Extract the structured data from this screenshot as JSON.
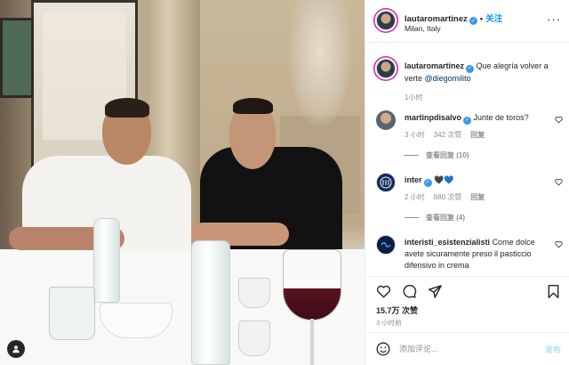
{
  "post": {
    "author": "lautaromartinez",
    "follow_label": "关注",
    "location": "Milan, Italy",
    "more_label": "···"
  },
  "comments": [
    {
      "user": "lautaromartinez",
      "verified": true,
      "text": "Que alegría volver a verte ",
      "mention": "@diegomilito",
      "time": "1小时"
    },
    {
      "user": "martinpdisalvo",
      "verified": true,
      "text": "Junte de toros?",
      "time": "3 小时",
      "likes": "342 次赞",
      "reply_label": "回复",
      "view_replies": "查看回复 (10)"
    },
    {
      "user": "inter",
      "verified": true,
      "text": "🖤💙",
      "time": "2 小时",
      "likes": "880 次赞",
      "reply_label": "回复",
      "view_replies": "查看回复 (4)"
    },
    {
      "user": "interisti_esistenzialisti",
      "verified": false,
      "text": "Come dolce avete sicuramente preso il pasticcio difensivo in crema"
    }
  ],
  "footer": {
    "likes": "15.7万 次赞",
    "post_time": "3 小时前",
    "comment_placeholder": "添加评论...",
    "post_label": "发布"
  },
  "colors": {
    "accent": "#0095f6",
    "verified": "#3897f0",
    "muted": "#8e8e8e",
    "post_disabled": "#b2dffc"
  },
  "icons": {
    "like": "heart-icon",
    "comment": "comment-icon",
    "share": "share-icon",
    "save": "bookmark-icon",
    "emoji": "emoji-icon",
    "tag": "user-tag-icon"
  }
}
